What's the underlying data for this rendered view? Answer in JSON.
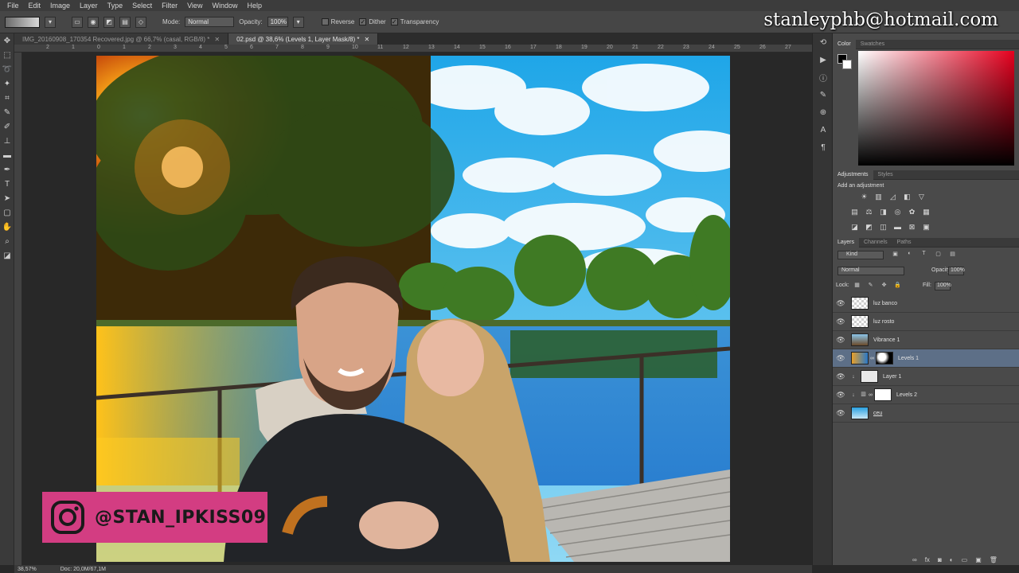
{
  "menu": [
    "File",
    "Edit",
    "Image",
    "Layer",
    "Type",
    "Select",
    "Filter",
    "View",
    "Window",
    "Help"
  ],
  "options": {
    "mode_label": "Mode:",
    "mode_value": "Normal",
    "opacity_label": "Opacity:",
    "opacity_value": "100%",
    "reverse_label": "Reverse",
    "dither_label": "Dither",
    "transparency_label": "Transparency"
  },
  "tabs": [
    {
      "title": "IMG_20160908_170354 Recovered.jpg @ 66,7% (casal, RGB/8) *",
      "active": false
    },
    {
      "title": "02.psd @ 38,6% (Levels 1, Layer Mask/8) *",
      "active": true
    }
  ],
  "ruler_numbers": [
    "2",
    "1",
    "0",
    "1",
    "2",
    "3",
    "4",
    "5",
    "6",
    "7",
    "8",
    "9",
    "10",
    "11",
    "12",
    "13",
    "14",
    "15",
    "16",
    "17",
    "18",
    "19",
    "20",
    "21",
    "22",
    "23",
    "24",
    "25",
    "26",
    "27"
  ],
  "watermark": {
    "email": "stanleyphb@hotmail.com",
    "instagram": "@STAN_IPKISS09"
  },
  "status": {
    "zoom": "38,57%",
    "doc": "Doc: 20,0M/67,1M"
  },
  "panels": {
    "color_tabs": [
      "Color",
      "Swatches"
    ],
    "adjust_tabs": [
      "Adjustments",
      "Styles"
    ],
    "add_adjustment": "Add an adjustment",
    "layer_tabs": [
      "Layers",
      "Channels",
      "Paths"
    ],
    "kind_value": "Kind",
    "blend_value": "Normal",
    "opacity_label": "Opacity:",
    "opacity_value": "100%",
    "lock_label": "Lock:",
    "fill_label": "Fill:",
    "fill_value": "100%"
  },
  "layers": [
    {
      "name": "luz banco",
      "selected": false
    },
    {
      "name": "luz rosto",
      "selected": false
    },
    {
      "name": "Vibrance 1",
      "selected": false
    },
    {
      "name": "Levels 1",
      "selected": true
    },
    {
      "name": "Layer 1",
      "selected": false
    },
    {
      "name": "Levels 2",
      "selected": false
    },
    {
      "name": "ceu",
      "selected": false
    }
  ],
  "icons": [
    "move-icon",
    "marquee-icon",
    "lasso-icon",
    "wand-icon",
    "crop-icon",
    "eyedropper-icon",
    "brush-icon",
    "stamp-icon",
    "gradient-icon",
    "pen-icon",
    "type-icon",
    "path-select-icon",
    "shape-icon",
    "hand-icon",
    "zoom-icon"
  ]
}
